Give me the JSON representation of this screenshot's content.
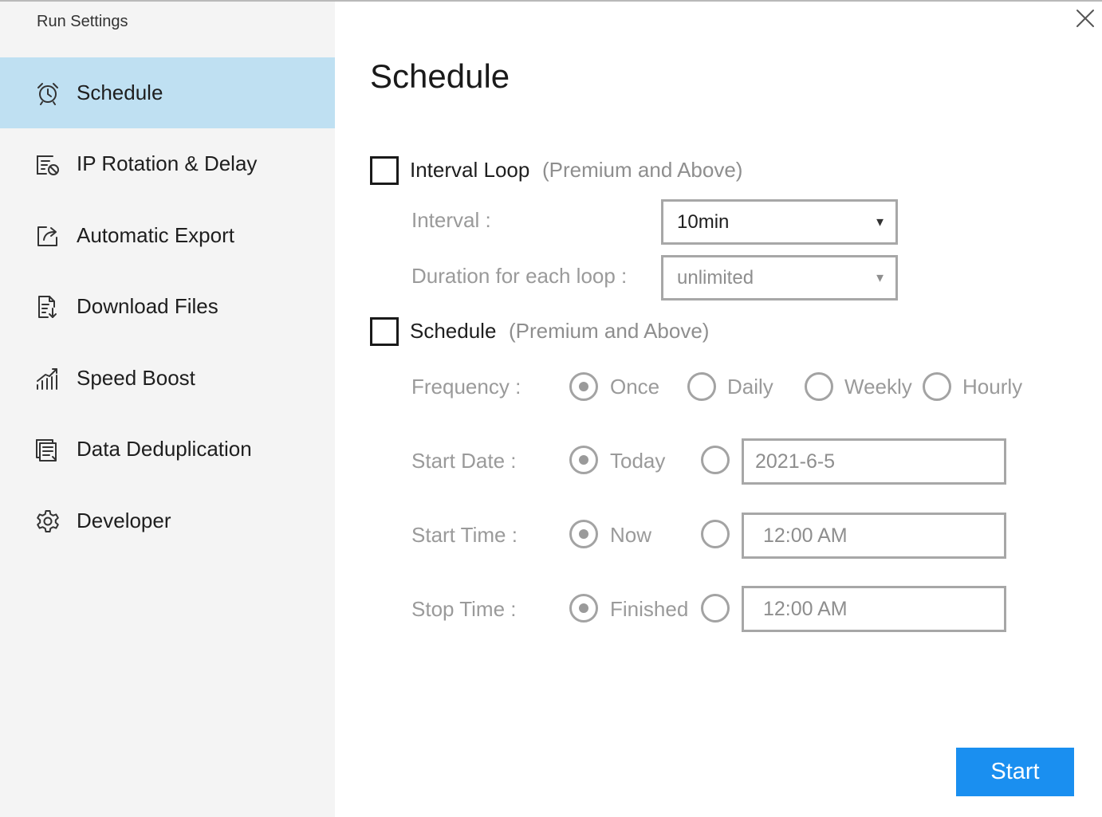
{
  "window": {
    "title": "Run Settings"
  },
  "sidebar": {
    "items": [
      {
        "label": "Schedule",
        "icon": "alarm-clock-icon",
        "active": true
      },
      {
        "label": "IP Rotation & Delay",
        "icon": "list-clock-icon",
        "active": false
      },
      {
        "label": "Automatic Export",
        "icon": "export-icon",
        "active": false
      },
      {
        "label": "Download Files",
        "icon": "download-file-icon",
        "active": false
      },
      {
        "label": "Speed Boost",
        "icon": "speed-chart-icon",
        "active": false
      },
      {
        "label": "Data Deduplication",
        "icon": "stacked-documents-icon",
        "active": false
      },
      {
        "label": "Developer",
        "icon": "gear-icon",
        "active": false
      }
    ]
  },
  "main": {
    "title": "Schedule",
    "interval_loop": {
      "label": "Interval Loop",
      "note": "(Premium and Above)",
      "checked": false,
      "interval_label": "Interval :",
      "interval_value": "10min",
      "duration_label": "Duration for each loop :",
      "duration_value": "unlimited"
    },
    "schedule": {
      "label": "Schedule",
      "note": "(Premium and Above)",
      "checked": false,
      "frequency": {
        "label": "Frequency :",
        "options": [
          "Once",
          "Daily",
          "Weekly",
          "Hourly"
        ],
        "selected": "Once"
      },
      "start_date": {
        "label": "Start Date :",
        "default_option": "Today",
        "value": "2021-6-5"
      },
      "start_time": {
        "label": "Start Time :",
        "default_option": "Now",
        "value": "12:00 AM"
      },
      "stop_time": {
        "label": "Stop Time :",
        "default_option": "Finished",
        "value": "12:00 AM"
      }
    },
    "start_button": "Start"
  },
  "colors": {
    "sidebar_bg": "#f4f4f4",
    "active_item_bg": "#bfe0f2",
    "primary_button": "#1a8ff0",
    "disabled_text": "#9a9a9a"
  }
}
